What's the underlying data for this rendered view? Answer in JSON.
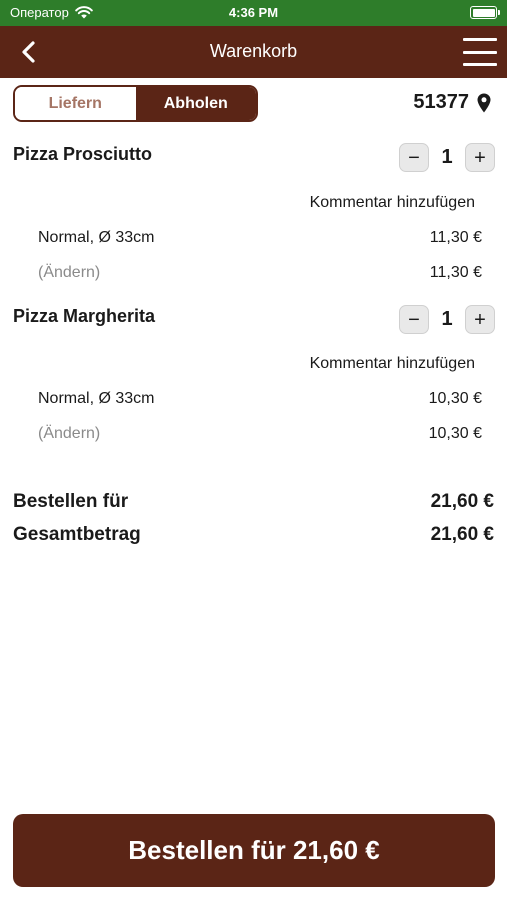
{
  "status": {
    "carrier": "Оператор",
    "time": "4:36 PM"
  },
  "nav": {
    "title": "Warenkorb"
  },
  "tabs": {
    "deliver": "Liefern",
    "pickup": "Abholen",
    "active": "pickup"
  },
  "location": {
    "zip": "51377"
  },
  "items": [
    {
      "name": "Pizza Prosciutto",
      "quantity": "1",
      "comment_label": "Kommentar hinzufügen",
      "size": "Normal, Ø 33cm",
      "size_price": "11,30 €",
      "change_label": "(Ändern)",
      "total": "11,30 €"
    },
    {
      "name": "Pizza Margherita",
      "quantity": "1",
      "comment_label": "Kommentar hinzufügen",
      "size": "Normal, Ø 33cm",
      "size_price": "10,30 €",
      "change_label": "(Ändern)",
      "total": "10,30 €"
    }
  ],
  "summary": {
    "order_for_label": "Bestellen für",
    "order_for_value": "21,60 €",
    "total_label": "Gesamtbetrag",
    "total_value": "21,60 €"
  },
  "cta": {
    "label": "Bestellen für 21,60 €"
  },
  "colors": {
    "statusbar": "#2e7d2a",
    "brand": "#5b2516",
    "muted": "#8a8a8a"
  }
}
